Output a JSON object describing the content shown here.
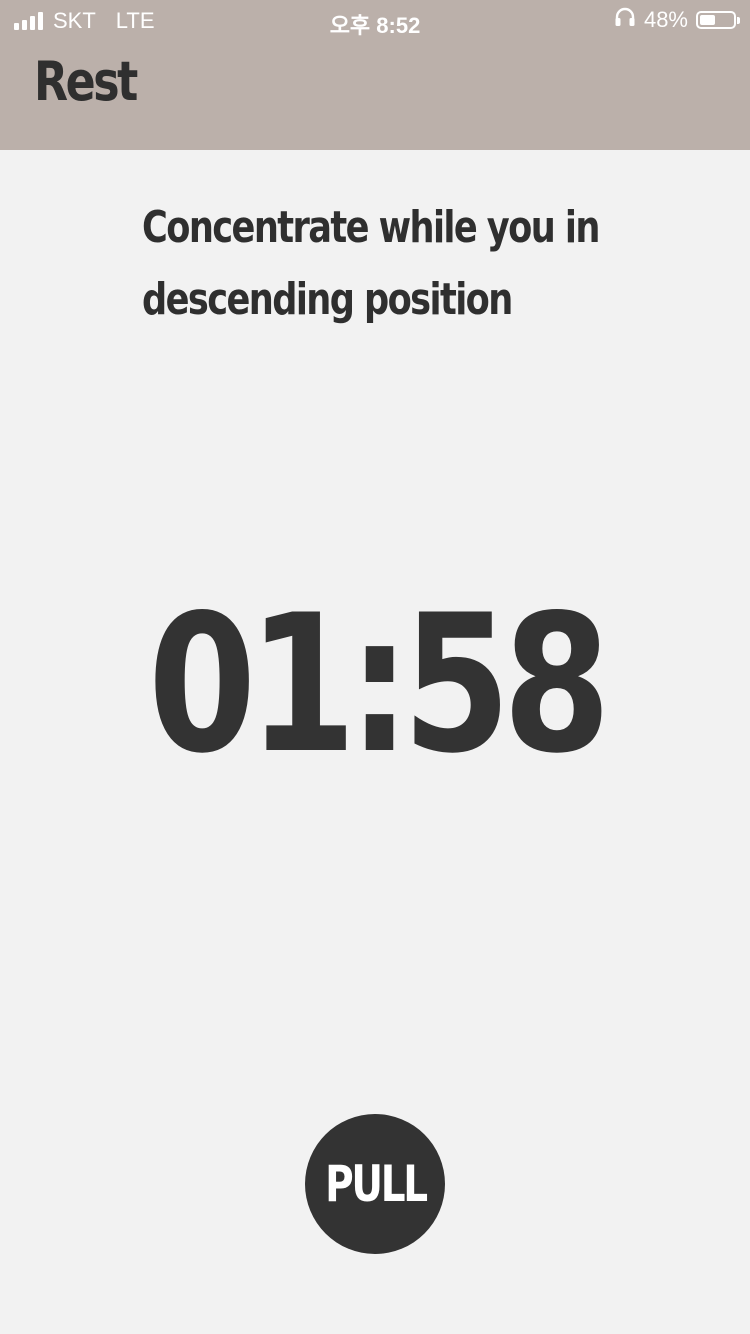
{
  "status_bar": {
    "carrier": "SKT",
    "network": "LTE",
    "time": "오후 8:52",
    "battery_percent_text": "48%",
    "battery_level": 0.48,
    "signal_bars": 4,
    "icons": [
      "signal-icon",
      "headphones-icon",
      "battery-icon"
    ]
  },
  "header": {
    "title": "Rest",
    "background_color": "#bbb0aa"
  },
  "main": {
    "instruction": "Concentrate while you in descending position",
    "timer": "01:58",
    "pull_button_label": "PULL"
  },
  "colors": {
    "background": "#f2f2f2",
    "text": "#333333",
    "button": "#333333"
  }
}
